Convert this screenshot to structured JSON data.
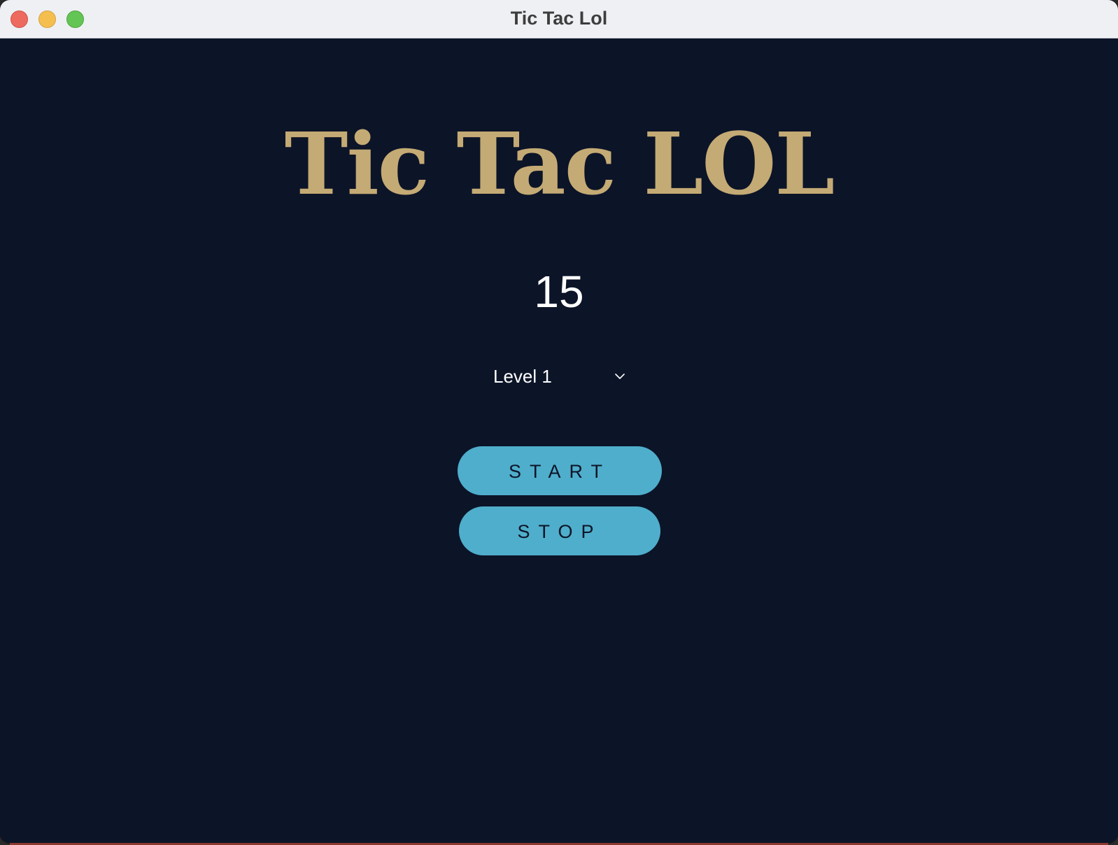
{
  "window": {
    "title": "Tic Tac Lol"
  },
  "game": {
    "title": "Tic Tac LOL",
    "counter": "15",
    "level": {
      "selected": "Level 1"
    },
    "buttons": {
      "start_label": "START",
      "stop_label": "STOP"
    }
  },
  "colors": {
    "background": "#0c1428",
    "title_gold": "#c4aa74",
    "button": "#4faecb",
    "titlebar": "#eef0f4"
  }
}
